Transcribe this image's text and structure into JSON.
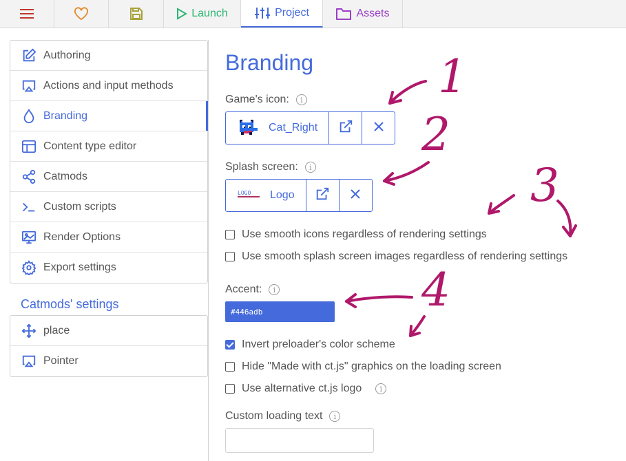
{
  "topbar": {
    "tabs": [
      {
        "id": "menu",
        "icon": "hamburger-menu-icon",
        "label": ""
      },
      {
        "id": "patrons",
        "icon": "heart-icon",
        "label": ""
      },
      {
        "id": "save",
        "icon": "save-icon",
        "label": ""
      },
      {
        "id": "launch",
        "icon": "play-icon",
        "label": "Launch"
      },
      {
        "id": "project",
        "icon": "sliders-icon",
        "label": "Project"
      },
      {
        "id": "assets",
        "icon": "folder-icon",
        "label": "Assets"
      }
    ]
  },
  "sidebar": {
    "items": [
      {
        "label": "Authoring",
        "icon": "edit-icon"
      },
      {
        "label": "Actions and input methods",
        "icon": "airplay-icon"
      },
      {
        "label": "Branding",
        "icon": "droplet-icon",
        "active": true
      },
      {
        "label": "Content type editor",
        "icon": "layout-icon"
      },
      {
        "label": "Catmods",
        "icon": "share-nodes-icon"
      },
      {
        "label": "Custom scripts",
        "icon": "terminal-icon"
      },
      {
        "label": "Render Options",
        "icon": "image-icon"
      },
      {
        "label": "Export settings",
        "icon": "gear-icon"
      }
    ],
    "catmods_heading": "Catmods' settings",
    "catmod_items": [
      {
        "label": "place",
        "icon": "move-icon"
      },
      {
        "label": "Pointer",
        "icon": "airplay-icon"
      }
    ]
  },
  "main": {
    "title": "Branding",
    "game_icon": {
      "label": "Game's icon:",
      "asset_name": "Cat_Right"
    },
    "splash": {
      "label": "Splash screen:",
      "asset_name": "Logo"
    },
    "checkboxes_render": [
      {
        "label": "Use smooth icons regardless of rendering settings",
        "checked": false
      },
      {
        "label": "Use smooth splash screen images regardless of rendering settings",
        "checked": false
      }
    ],
    "accent": {
      "label": "Accent:",
      "value": "#446adb"
    },
    "checkboxes_preloader": [
      {
        "label": "Invert preloader's color scheme",
        "checked": true
      },
      {
        "label": "Hide \"Made with ct.js\" graphics on the loading screen",
        "checked": false
      },
      {
        "label": "Use alternative ct.js logo",
        "checked": false
      }
    ],
    "custom_loading": {
      "label": "Custom loading text",
      "value": ""
    }
  },
  "annotations": [
    "1",
    "2",
    "3",
    "4"
  ],
  "colors": {
    "accent": "#446adb",
    "annotation": "#b0186a",
    "launch": "#2bb673",
    "heart": "#e08a2a",
    "save": "#a8a23a",
    "assets": "#9b3fc6",
    "menu": "#c0392b"
  }
}
